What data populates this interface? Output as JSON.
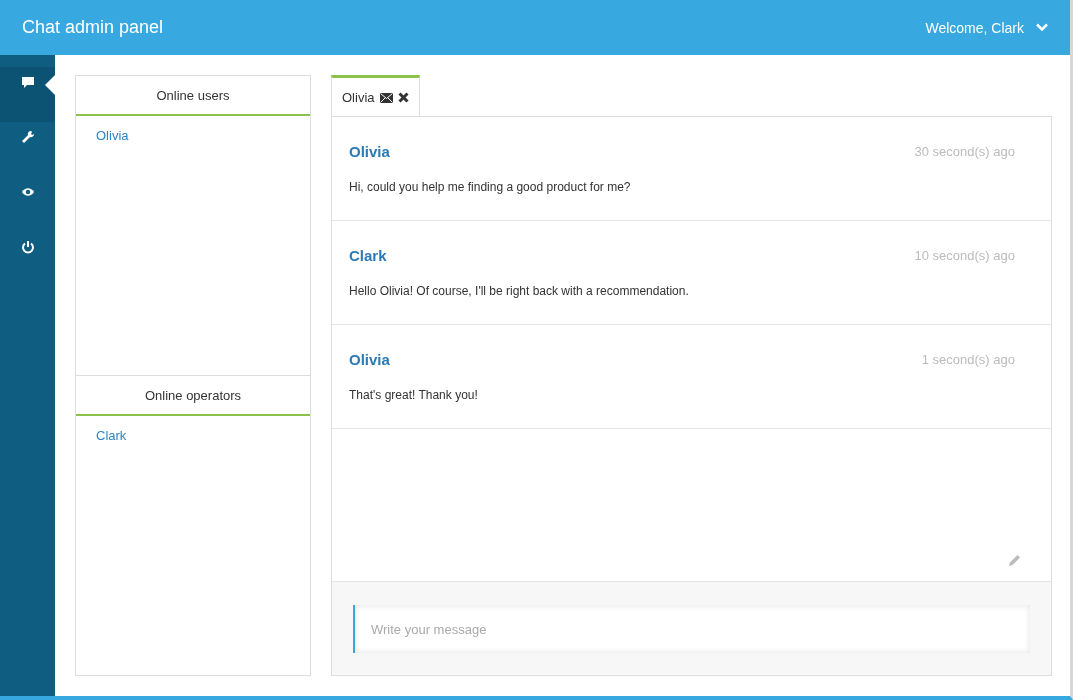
{
  "header": {
    "title": "Chat admin panel",
    "user_menu": "Welcome, Clark"
  },
  "sidebar": {
    "items": [
      {
        "kind": "chat",
        "selected": true
      },
      {
        "kind": "tools",
        "selected": false
      },
      {
        "kind": "view",
        "selected": false
      },
      {
        "kind": "power",
        "selected": false
      }
    ]
  },
  "online_users": {
    "title": "Online users",
    "users": [
      "Olivia"
    ]
  },
  "online_operators": {
    "title": "Online operators",
    "users": [
      "Clark"
    ]
  },
  "chat_tabs": [
    {
      "label": "Olivia",
      "selected": true
    }
  ],
  "messages": [
    {
      "author": "Olivia",
      "time": "30 second(s) ago",
      "text": "Hi, could you help me finding a good product for me?"
    },
    {
      "author": "Clark",
      "time": "10 second(s) ago",
      "text": "Hello Olivia! Of course, I'll be right back with a recommendation."
    },
    {
      "author": "Olivia",
      "time": "1 second(s) ago",
      "text": "That's great! Thank you!"
    }
  ],
  "composer": {
    "placeholder": "Write your message"
  }
}
